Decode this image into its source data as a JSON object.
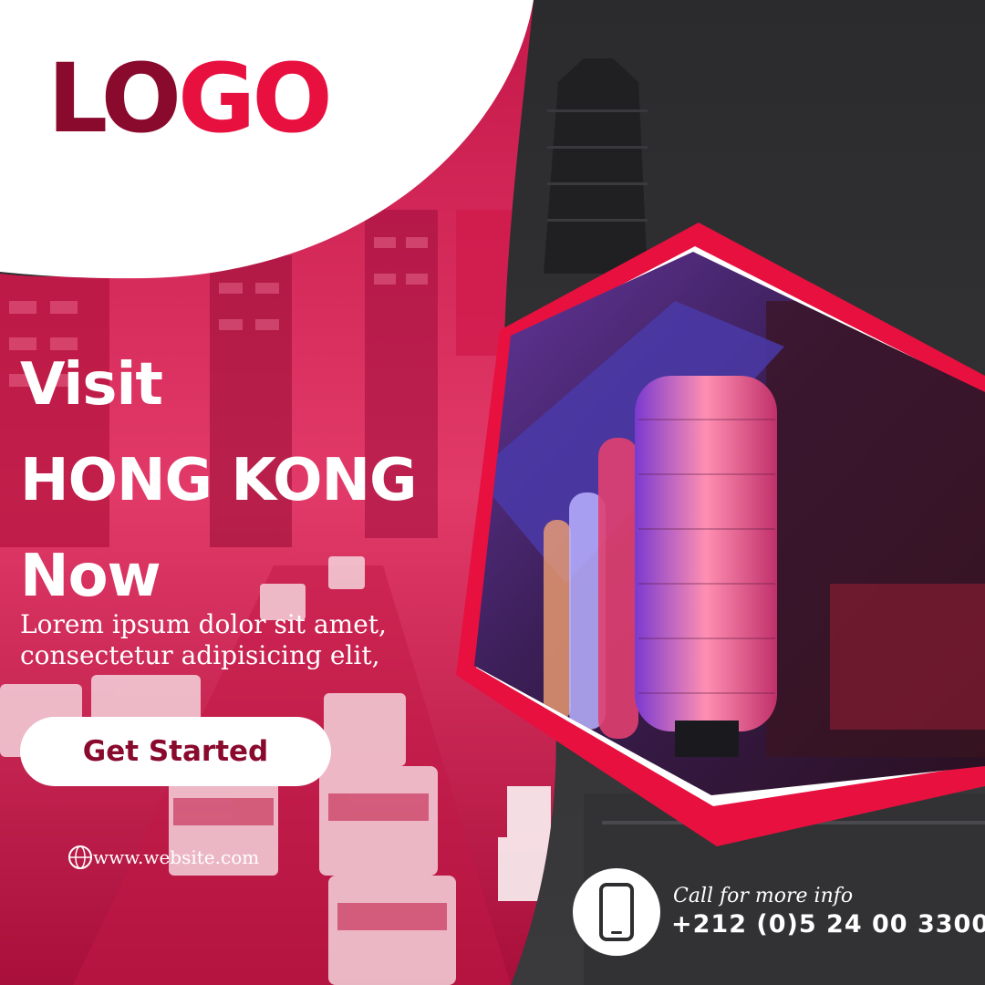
{
  "brand": {
    "logo_part1": "LO",
    "logo_part2": "GO"
  },
  "hero": {
    "line1": "Visit",
    "line2": "HONG KONG",
    "line3": "Now",
    "description_line1": "Lorem ipsum dolor sit amet,",
    "description_line2": "consectetur adipisicing elit,"
  },
  "cta": {
    "label": "Get Started"
  },
  "contact": {
    "website": "www.website.com",
    "call_label": "Call for more info",
    "phone": "+212 (0)5 24 00 3300"
  },
  "colors": {
    "accent": "#e8103f",
    "dark_accent": "#8a0a2e",
    "background": "#2e2e30"
  }
}
